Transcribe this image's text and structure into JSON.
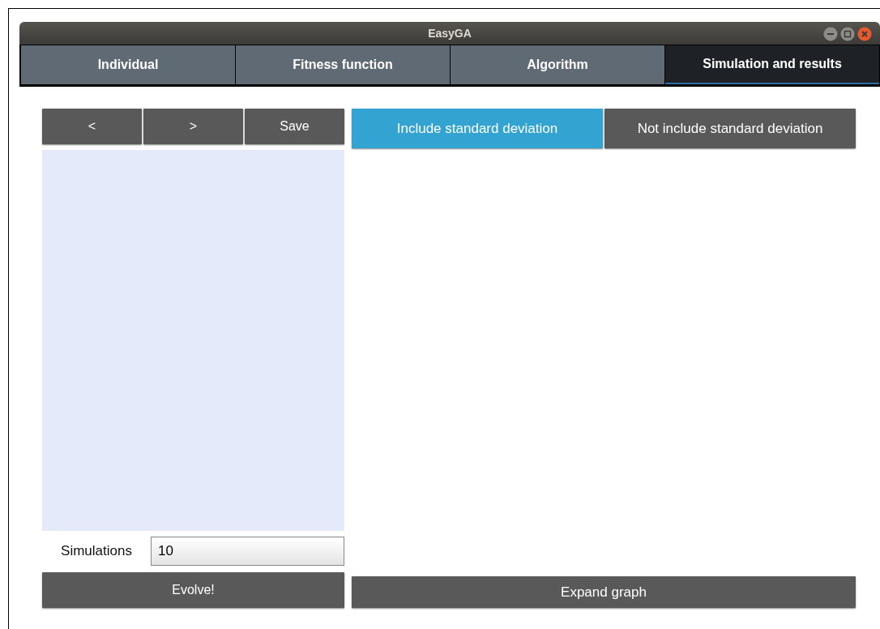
{
  "window": {
    "title": "EasyGA"
  },
  "tabs": [
    {
      "label": "Individual",
      "selected": false
    },
    {
      "label": "Fitness function",
      "selected": false
    },
    {
      "label": "Algorithm",
      "selected": false
    },
    {
      "label": "Simulation and results",
      "selected": true
    }
  ],
  "navigation": {
    "buttons": [
      "<",
      ">",
      "Save"
    ]
  },
  "deviation_toggle": [
    {
      "label": "Include standard deviation",
      "selected": true
    },
    {
      "label": "Not include standard deviation",
      "selected": false
    }
  ],
  "simulations": {
    "label": "Simulations",
    "value": "10"
  },
  "evolve_button": "Evolve!",
  "expand_button": "Expand graph"
}
